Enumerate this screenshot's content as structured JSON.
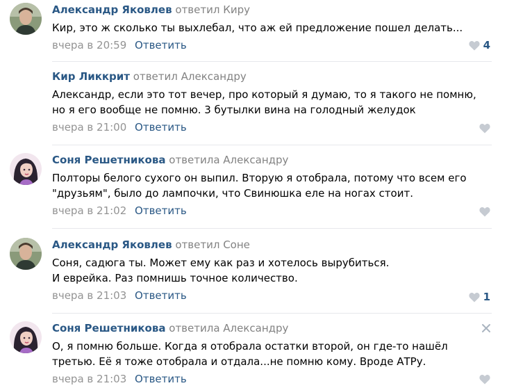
{
  "colors": {
    "author": "#2a5885",
    "link": "#2a5885",
    "muted": "#828282",
    "heart": "#c6cbd2",
    "separator": "#e7e8ec"
  },
  "comments": [
    {
      "author": "Александр Яковлев",
      "replied": "ответил Киру",
      "lines": [
        "Кир, это ж сколько ты выхлебал, что аж ей предложение пошел делать..."
      ],
      "date": "вчера в 20:59",
      "reply": "Ответить",
      "likes": "4",
      "avatar": "man-photo"
    },
    {
      "author": "Кир Ликкрит",
      "replied": "ответил Александру",
      "lines": [
        "Александр, если это тот вечер, про который я думаю, то я такого не помню,",
        "но я его вообще не помню. 3 бутылки вина на голодный желудок"
      ],
      "date": "вчера в 21:00",
      "reply": "Ответить",
      "likes": "",
      "avatar": "none"
    },
    {
      "author": "Соня Решетникова",
      "replied": "ответила Александру",
      "lines": [
        "Полторы белого сухого он выпил. Вторую я отобрала, потому что всем его",
        "\"друзьям\", было до лампочки, что Свинюшка еле на ногах стоит."
      ],
      "date": "вчера в 21:02",
      "reply": "Ответить",
      "likes": "",
      "avatar": "woman-illustration"
    },
    {
      "author": "Александр Яковлев",
      "replied": "ответил Соне",
      "lines": [
        "Соня, садюга ты. Может ему как раз и хотелось вырубиться.",
        "И еврейка. Раз помнишь точное количество."
      ],
      "date": "вчера в 21:03",
      "reply": "Ответить",
      "likes": "1",
      "avatar": "man-photo"
    },
    {
      "author": "Соня Решетникова",
      "replied": "ответила Александру",
      "lines": [
        "О, я помню больше. Когда я отобрала остатки второй, он где-то нашёл",
        "третью. Её я тоже отобрала и отдала...не помню кому. Вроде АТРу."
      ],
      "date": "вчера в 21:03",
      "reply": "Ответить",
      "likes": "",
      "avatar": "woman-illustration"
    }
  ]
}
